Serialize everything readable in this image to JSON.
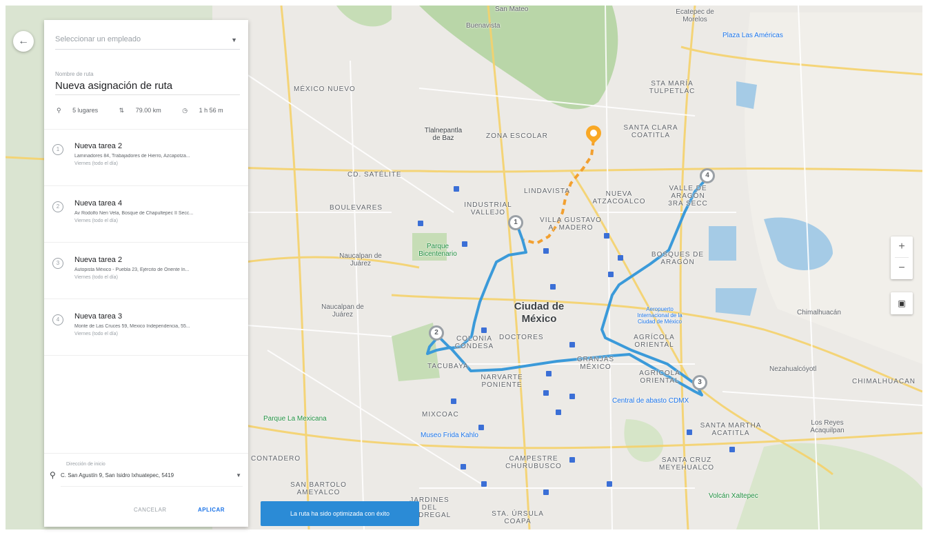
{
  "panel": {
    "employee_placeholder": "Seleccionar un empleado",
    "route_name_label": "Nombre de ruta",
    "route_name": "Nueva asignación de ruta",
    "stats": {
      "places": "5 lugares",
      "distance": "79.00 km",
      "duration": "1 h 56 m"
    },
    "tasks": [
      {
        "number": "1",
        "title": "Nueva tarea 2",
        "address": "Laminadores 84, Trabajadores de Hierro, Azcapotza...",
        "schedule": "Viernes (todo el día)"
      },
      {
        "number": "2",
        "title": "Nueva tarea 4",
        "address": "Av Rodolfo Neri Vela, Bosque de Chapultepec II Secc...",
        "schedule": "Viernes (todo el día)"
      },
      {
        "number": "3",
        "title": "Nueva tarea 2",
        "address": "Autopista México - Puebla 23, Ejército de Oriente In...",
        "schedule": "Viernes (todo el día)"
      },
      {
        "number": "4",
        "title": "Nueva tarea 3",
        "address": "Monte de Las Cruces 59, Mexico Independencia, 55...",
        "schedule": "Viernes (todo el día)"
      }
    ],
    "start_label": "Dirección de inicio",
    "start_address": "C. San Agustín 9, San Isidro Ixhuatepec, 5419",
    "cancel_label": "CANCELAR",
    "apply_label": "APLICAR"
  },
  "toast": "La ruta ha sido optimizada con éxito",
  "map": {
    "labels": {
      "buenavista": "Buenavista",
      "san_mateo": "San Mateo",
      "ecatepec": "Ecatepec de Morelos",
      "plaza_las_americas": "Plaza Las Américas",
      "mexico_nuevo": "MÉXICO NUEVO",
      "sta_maria_tulpetlac": "STA MARÍA TULPETLAC",
      "tlalnepantla": "Tlalnepantla de Baz",
      "zona_escolar": "ZONA ESCOLAR",
      "santa_clara": "SANTA CLARA COATITLA",
      "cd_satelite": "CD. SATÉLITE",
      "lindavista": "LINDAVISTA",
      "nueva_atzacoalco": "NUEVA ATZACOALCO",
      "valle_aragon": "VALLE DE ARAGÓN 3RA SECC",
      "boulevares": "BOULEVARES",
      "industrial_vallejo": "INDUSTRIAL VALLEJO",
      "villa_gustavo": "VILLA GUSTAVO A. MADERO",
      "bosques_aragon": "BOSQUES DE ARAGÓN",
      "parque_bicentenario": "Parque Bicentenario",
      "naucalpan": "Naucalpan de Juárez",
      "ciudad_mexico": "Ciudad de México",
      "aeropuerto": "Aeropuerto Internacional de la Ciudad de México",
      "colonia_condesa": "COLONIA CONDESA",
      "doctores": "DOCTORES",
      "agricola_oriental": "AGRÍCOLA ORIENTAL",
      "granjas_mexico": "GRANJAS MÉXICO",
      "chimalhuacan": "Chimalhuacán",
      "tacubaya": "TACUBAYA",
      "narvarte": "NARVARTE PONIENTE",
      "central_abasto": "Central de abasto CDMX",
      "mixcoac": "MIXCOAC",
      "museo_frida": "Museo Frida Kahlo",
      "santa_martha": "SANTA MARTHA ACATITLA",
      "los_reyes": "Los Reyes Acaquilpan",
      "parque_mexicana": "Parque La Mexicana",
      "contadero": "CONTADERO",
      "campestre": "CAMPESTRE CHURUBUSCO",
      "santa_cruz": "SANTA CRUZ MEYEHUALCO",
      "san_bartolo": "SAN BARTOLO AMEYALCO",
      "jardines": "JARDINES DEL PEDREGAL",
      "sta_ursula": "STA. ÚRSULA COAPA",
      "chimalhuacan_caps": "CHIMALHUACAN",
      "nezahualcoyotl": "Nezahualcóyotl",
      "volcan": "Volcán Xaltepec"
    },
    "markers": [
      "1",
      "2",
      "3",
      "4"
    ],
    "route_color": "#3b9ad9",
    "origin_color": "#f9a825"
  },
  "controls": {
    "zoom_in": "+",
    "zoom_out": "−"
  }
}
